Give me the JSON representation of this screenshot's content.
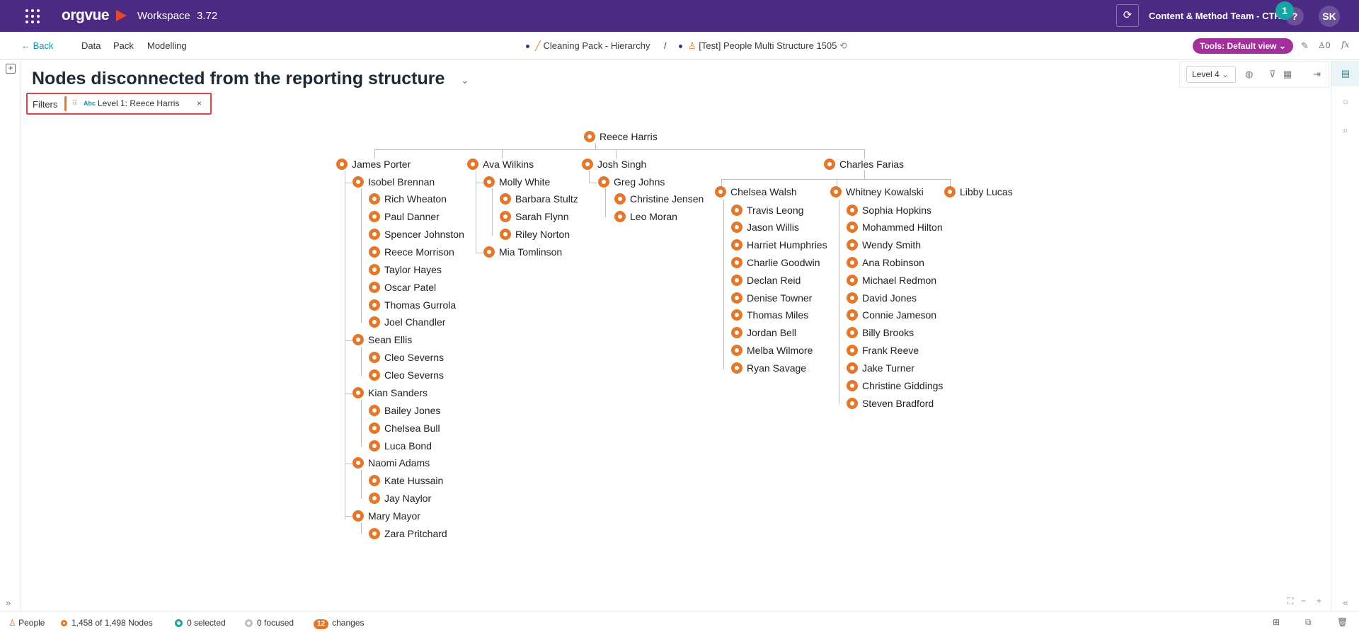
{
  "app": {
    "logo": "orgvue",
    "workspace_label": "Workspace",
    "version": "3.72",
    "team": "Content & Method Team - CTR",
    "help": "?",
    "notification_count": "1",
    "avatar": "SK",
    "brand_color": "#4a2a83",
    "accent_color": "#e4772a"
  },
  "nav": {
    "back": "Back",
    "items": [
      "Data",
      "Pack",
      "Modelling"
    ],
    "crumb1": "Cleaning Pack - Hierarchy",
    "separator": "/",
    "crumb2": "[Test] People Multi Structure 1505",
    "tools": "Tools: Default view",
    "users_count": "0",
    "fx": "fx"
  },
  "toolbar": {
    "level": "Level 4"
  },
  "page": {
    "title": "Nodes disconnected from the reporting structure"
  },
  "filters": {
    "label": "Filters",
    "chip_type": "Abc",
    "chip_text": "Level 1: Reece Harris",
    "close": "×"
  },
  "tree": {
    "root": "Reece Harris",
    "children": [
      {
        "name": "James Porter",
        "children": [
          {
            "name": "Isobel Brennan",
            "children": [
              "Rich Wheaton",
              "Paul Danner",
              "Spencer Johnston",
              "Reece Morrison",
              "Taylor Hayes",
              "Oscar Patel",
              "Thomas Gurrola",
              "Joel Chandler"
            ]
          },
          {
            "name": "Sean Ellis",
            "children": [
              "Cleo Severns",
              "Cleo Severns"
            ]
          },
          {
            "name": "Kian Sanders",
            "children": [
              "Bailey Jones",
              "Chelsea Bull",
              "Luca Bond"
            ]
          },
          {
            "name": "Naomi Adams",
            "children": [
              "Kate Hussain",
              "Jay Naylor"
            ]
          },
          {
            "name": "Mary Mayor",
            "children": [
              "Zara Pritchard"
            ]
          }
        ]
      },
      {
        "name": "Ava Wilkins",
        "children": [
          {
            "name": "Molly White",
            "children": [
              "Barbara Stultz",
              "Sarah Flynn",
              "Riley Norton"
            ]
          },
          {
            "name": "Mia Tomlinson",
            "children": []
          }
        ]
      },
      {
        "name": "Josh Singh",
        "children": [
          {
            "name": "Greg Johns",
            "children": [
              "Christine Jensen",
              "Leo Moran"
            ]
          }
        ]
      },
      {
        "name": "Charles Farias",
        "children": [
          {
            "name": "Chelsea Walsh",
            "children": [
              "Travis Leong",
              "Jason Willis",
              "Harriet Humphries",
              "Charlie Goodwin",
              "Declan Reid",
              "Denise Towner",
              "Thomas Miles",
              "Jordan Bell",
              "Melba Wilmore",
              "Ryan Savage"
            ]
          },
          {
            "name": "Whitney Kowalski",
            "children": [
              "Sophia Hopkins",
              "Mohammed Hilton",
              "Wendy Smith",
              "Ana Robinson",
              "Michael Redmon",
              "David Jones",
              "Connie Jameson",
              "Billy Brooks",
              "Frank Reeve",
              "Jake Turner",
              "Christine Giddings",
              "Steven Bradford"
            ]
          },
          {
            "name": "Libby Lucas",
            "children": []
          }
        ]
      }
    ]
  },
  "status": {
    "dataset": "People",
    "nodes": "1,458 of 1,498 Nodes",
    "selected": "0 selected",
    "focused": "0 focused",
    "changes_count": "12",
    "changes_label": "changes"
  }
}
